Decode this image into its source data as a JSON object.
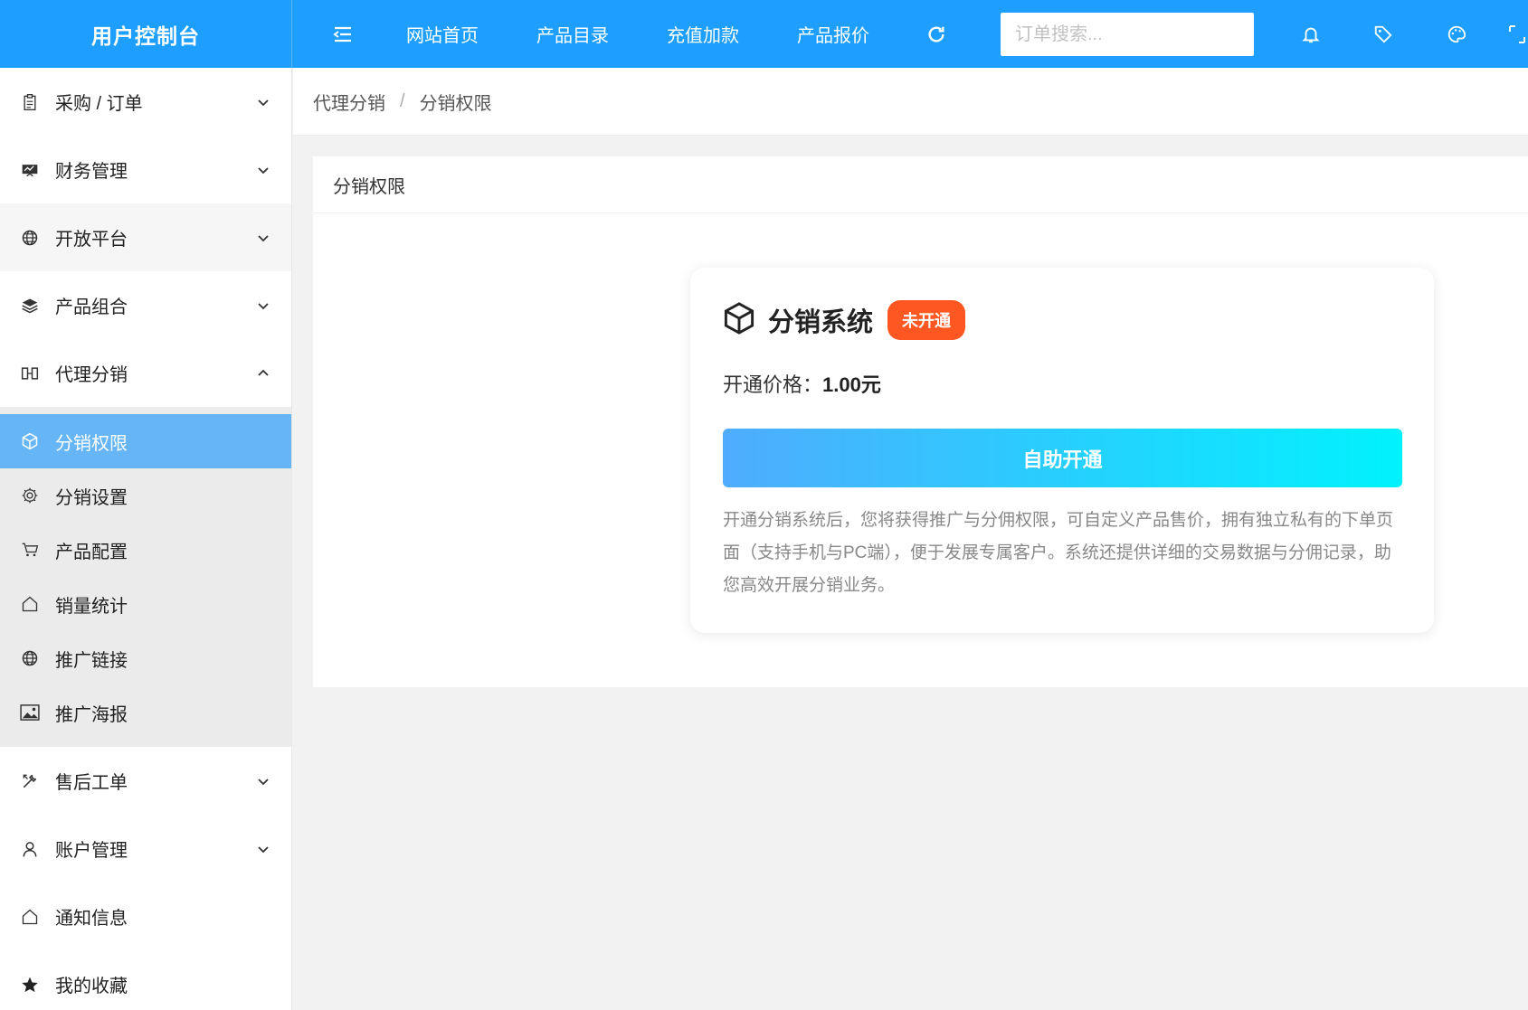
{
  "header": {
    "app_title": "用户控制台",
    "nav": [
      "网站首页",
      "产品目录",
      "充值加款",
      "产品报价"
    ],
    "search_placeholder": "订单搜索..."
  },
  "sidebar": {
    "items": [
      {
        "label": "采购 / 订单",
        "icon": "clipboard-icon",
        "expanded": false
      },
      {
        "label": "财务管理",
        "icon": "finance-icon",
        "expanded": false
      },
      {
        "label": "开放平台",
        "icon": "globe-icon",
        "expanded": false
      },
      {
        "label": "产品组合",
        "icon": "layers-icon",
        "expanded": false
      },
      {
        "label": "代理分销",
        "icon": "agent-icon",
        "expanded": true
      }
    ],
    "submenu": [
      {
        "label": "分销权限",
        "icon": "box-icon",
        "active": true
      },
      {
        "label": "分销设置",
        "icon": "gear-icon",
        "active": false
      },
      {
        "label": "产品配置",
        "icon": "cart-icon",
        "active": false
      },
      {
        "label": "销量统计",
        "icon": "home-icon",
        "active": false
      },
      {
        "label": "推广链接",
        "icon": "globe-icon",
        "active": false
      },
      {
        "label": "推广海报",
        "icon": "image-icon",
        "active": false
      }
    ],
    "bottom_items": [
      {
        "label": "售后工单",
        "icon": "tools-icon",
        "has_arrow": true
      },
      {
        "label": "账户管理",
        "icon": "user-icon",
        "has_arrow": true
      },
      {
        "label": "通知信息",
        "icon": "home-icon",
        "has_arrow": false
      },
      {
        "label": "我的收藏",
        "icon": "star-icon",
        "has_arrow": false
      }
    ]
  },
  "breadcrumb": {
    "parent": "代理分销",
    "separator": "/",
    "current": "分销权限"
  },
  "card": {
    "title": "分销权限",
    "system_title": "分销系统",
    "status_badge": "未开通",
    "price_label": "开通价格：",
    "price_value": "1.00元",
    "button_label": "自助开通",
    "description": "开通分销系统后，您将获得推广与分佣权限，可自定义产品售价，拥有独立私有的下单页面（支持手机与PC端），便于发展专属客户。系统还提供详细的交易数据与分佣记录，助您高效开展分销业务。"
  },
  "colors": {
    "primary": "#1e9fff",
    "active_submenu": "#66b5f7",
    "badge": "#ff5722",
    "button_gradient_start": "#4facfe",
    "button_gradient_end": "#00f2fe"
  }
}
